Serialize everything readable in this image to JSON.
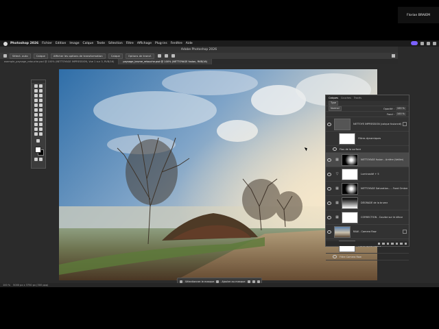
{
  "menubar": {
    "app": "Photoshop 2026",
    "items": [
      "Fichier",
      "Edition",
      "Image",
      "Calque",
      "Texte",
      "Sélection",
      "Filtre",
      "Affichage",
      "Plug-ins",
      "Fenêtre",
      "Aide"
    ]
  },
  "title": "Adobe Photoshop 2026",
  "presenter": "Florian BRAIEM",
  "options": {
    "auto_select": "Sélect. auto",
    "layer_select": "Calque",
    "show_transform": "Afficher les options de transformation",
    "layer_mode": "Calque",
    "bounding": "Options de transf."
  },
  "tabs": [
    {
      "label": "exemple_paysage_retouche.psd @ 100% (NETTOYAGE IMPRESSION, Vue 1 sur 3, RVB/16)"
    },
    {
      "label": "paysage_brume_retouche.psd @ 100% (NETTOYAGE fusion, RVB/16)",
      "active": true
    }
  ],
  "context_bar": {
    "select_mask": "Sélectionner le masque",
    "add_mask": "Ajouter au masque"
  },
  "status": {
    "zoom": "100 %",
    "size": "5000 px x 3750 px (300 ppp)"
  },
  "layers_panel": {
    "tabs": [
      "Calques",
      "Couches",
      "Tracés"
    ],
    "kind": "Type",
    "mode": "Normal",
    "opacity_label": "Opacité :",
    "opacity": "100 %",
    "fill_label": "Fond :",
    "fill": "100 %",
    "layers": [
      {
        "name": "NETTOYE IMPRESSION (calque fusionné)",
        "type": "group"
      },
      {
        "name": "Filtres dynamiques",
        "type": "smart"
      },
      {
        "name": "Flou de la surface",
        "type": "filter"
      },
      {
        "name": "NETTOYAGE fusion - Arrière (Veiller)",
        "type": "mask",
        "selected": true
      },
      {
        "name": "Luminosité + 5",
        "type": "adj"
      },
      {
        "name": "NETTOYAGE Saturation... - Fond Ombre",
        "type": "mask"
      },
      {
        "name": "DÉGRADÉ de la brume",
        "type": "mask"
      },
      {
        "name": "CORRECTION - Courbe sur le décor",
        "type": "mask"
      },
      {
        "name": "RAW - Camera Raw",
        "type": "photo"
      },
      {
        "name": "Filtres dynamiques",
        "type": "smart"
      },
      {
        "name": "Filtre Camera Raw",
        "type": "filter"
      }
    ]
  }
}
